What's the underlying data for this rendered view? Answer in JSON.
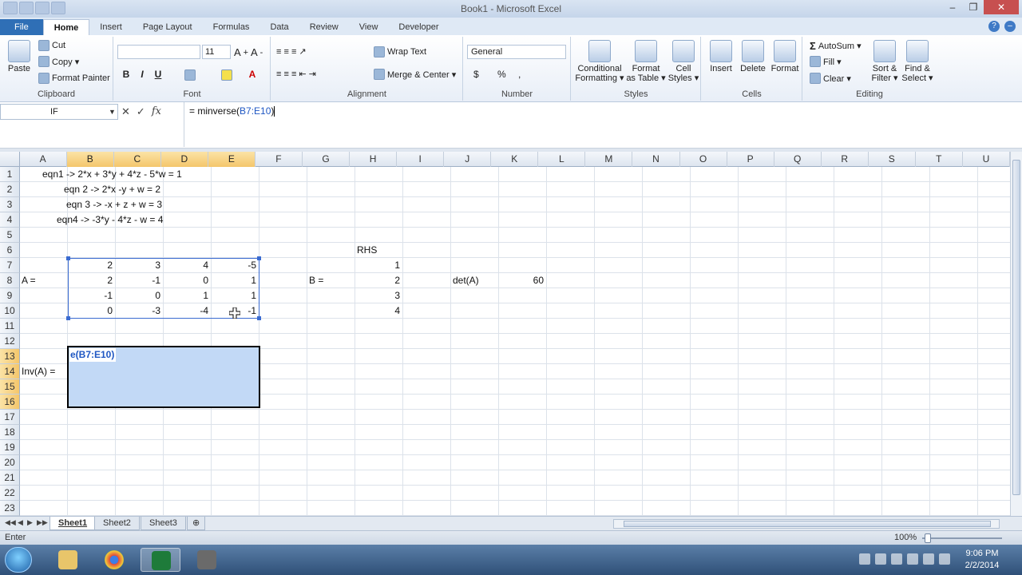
{
  "window": {
    "title": "Book1 - Microsoft Excel"
  },
  "tabs": [
    "File",
    "Home",
    "Insert",
    "Page Layout",
    "Formulas",
    "Data",
    "Review",
    "View",
    "Developer"
  ],
  "ribbon": {
    "clipboard": {
      "label": "Clipboard",
      "paste": "Paste",
      "cut": "Cut",
      "copy": "Copy ▾",
      "format_painter": "Format Painter"
    },
    "font": {
      "label": "Font",
      "size": "11"
    },
    "alignment": {
      "label": "Alignment",
      "wrap_text": "Wrap Text",
      "merge_center": "Merge & Center ▾"
    },
    "number": {
      "label": "Number",
      "format": "General",
      "currency": "$",
      "percent": "%",
      "comma": ","
    },
    "styles": {
      "label": "Styles",
      "conditional": "Conditional\nFormatting ▾",
      "format_table": "Format\nas Table ▾",
      "cell_styles": "Cell\nStyles ▾"
    },
    "cells": {
      "label": "Cells",
      "insert": "Insert",
      "delete": "Delete",
      "format": "Format"
    },
    "editing": {
      "label": "Editing",
      "autosum": "AutoSum ▾",
      "fill": "Fill ▾",
      "clear": "Clear ▾",
      "sort_filter": "Sort &\nFilter ▾",
      "find_select": "Find &\nSelect ▾"
    }
  },
  "formula_bar": {
    "name_box": "IF",
    "formula_prefix": "= minverse(",
    "formula_ref": "B7:E10",
    "formula_suffix": ")"
  },
  "columns": [
    "A",
    "B",
    "C",
    "D",
    "E",
    "F",
    "G",
    "H",
    "I",
    "J",
    "K",
    "L",
    "M",
    "N",
    "O",
    "P",
    "Q",
    "R",
    "S",
    "T",
    "U"
  ],
  "rows": [
    "1",
    "2",
    "3",
    "4",
    "5",
    "6",
    "7",
    "8",
    "9",
    "10",
    "11",
    "12",
    "13",
    "14",
    "15",
    "16",
    "17",
    "18",
    "19",
    "20",
    "21",
    "22",
    "23"
  ],
  "cells": {
    "r1": "eqn1 -> 2*x + 3*y + 4*z - 5*w = 1",
    "r2": "eqn 2 -> 2*x -y + w = 2",
    "r3": "eqn 3 -> -x + z + w = 3",
    "r4": "eqn4 -> -3*y - 4*z - w = 4",
    "rhs": "RHS",
    "a_label": "A =",
    "b_label": "B =",
    "det_label": "det(A)",
    "det_value": "60",
    "inv_label": "Inv(A) =",
    "edit_text": "e(B7:E10)"
  },
  "matrixA": [
    [
      "2",
      "3",
      "4",
      "-5"
    ],
    [
      "2",
      "-1",
      "0",
      "1"
    ],
    [
      "-1",
      "0",
      "1",
      "1"
    ],
    [
      "0",
      "-3",
      "-4",
      "-1"
    ]
  ],
  "vectorB": [
    "1",
    "2",
    "3",
    "4"
  ],
  "sheets": [
    "Sheet1",
    "Sheet2",
    "Sheet3"
  ],
  "status": {
    "mode": "Enter",
    "zoom": "100%"
  },
  "clock": {
    "time": "9:06 PM",
    "date": "2/2/2014"
  },
  "colors": {
    "accent": "#2f6fb6",
    "selection": "#c2d9f6",
    "header_selected": "#f4c66b"
  }
}
